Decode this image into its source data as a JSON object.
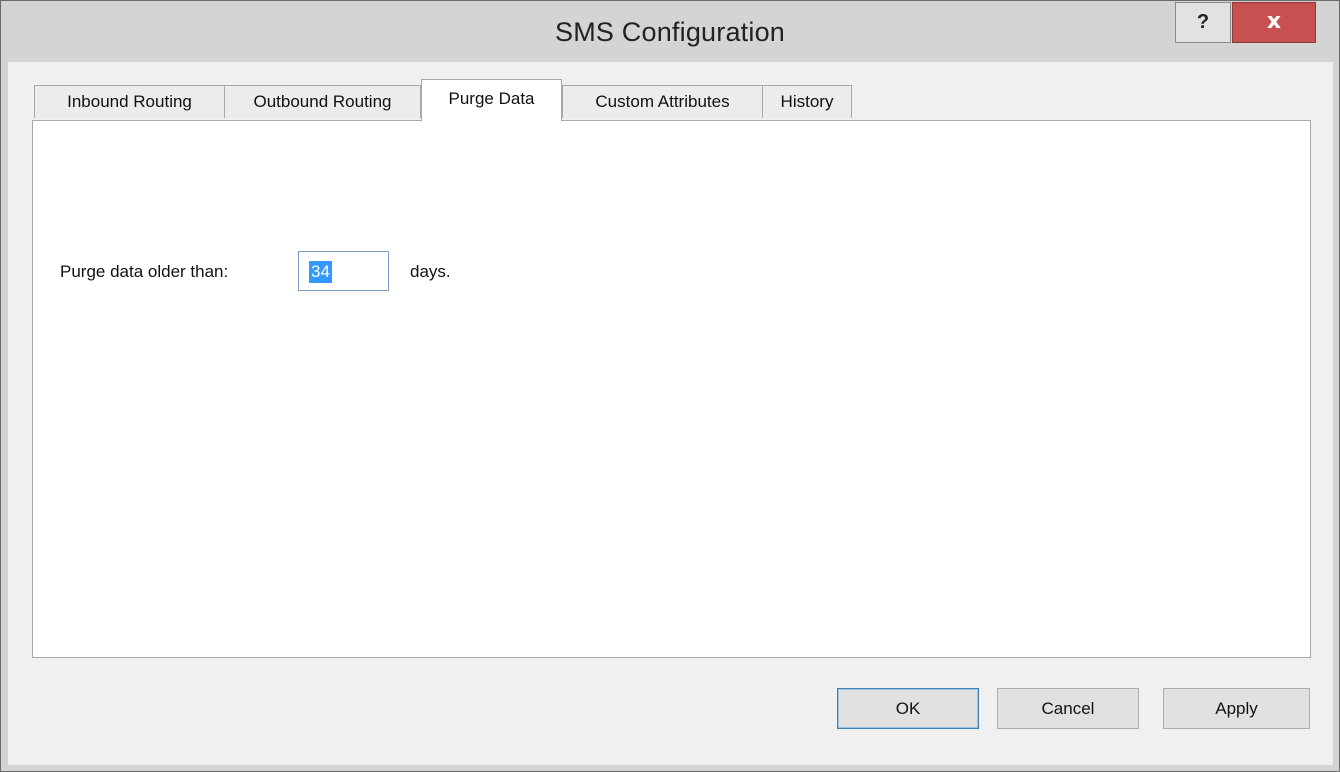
{
  "window": {
    "title": "SMS Configuration",
    "help_label": "?",
    "close_label": "x"
  },
  "tabs": [
    {
      "label": "Inbound Routing",
      "active": false
    },
    {
      "label": "Outbound Routing",
      "active": false
    },
    {
      "label": "Purge Data",
      "active": true
    },
    {
      "label": "Custom Attributes",
      "active": false
    },
    {
      "label": "History",
      "active": false
    }
  ],
  "purge": {
    "label": "Purge data older than:",
    "value": "34",
    "unit": "days."
  },
  "buttons": {
    "ok": "OK",
    "cancel": "Cancel",
    "apply": "Apply"
  },
  "colors": {
    "close_button": "#c75050",
    "selection": "#3399ff",
    "default_button_border": "#3c7fb1"
  }
}
